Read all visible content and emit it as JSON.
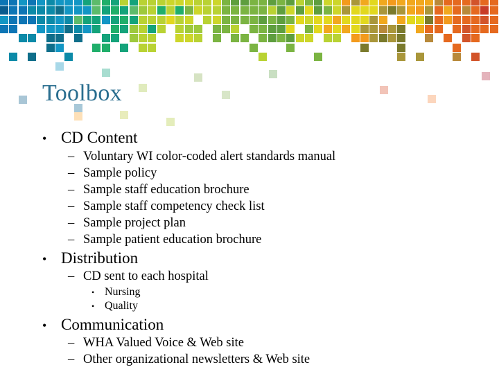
{
  "slide": {
    "title": "Toolbox",
    "sections": [
      {
        "label": "CD Content",
        "items": [
          {
            "label": "Voluntary WI color-coded alert standards manual",
            "subitems": []
          },
          {
            "label": "Sample policy",
            "subitems": []
          },
          {
            "label": "Sample staff education brochure",
            "subitems": []
          },
          {
            "label": "Sample staff competency check list",
            "subitems": []
          },
          {
            "label": "Sample project plan",
            "subitems": []
          },
          {
            "label": "Sample patient education brochure",
            "subitems": []
          }
        ]
      },
      {
        "label": "Distribution",
        "items": [
          {
            "label": "CD sent to each hospital",
            "subitems": [
              "Nursing",
              "Quality"
            ]
          }
        ]
      },
      {
        "label": "Communication",
        "items": [
          {
            "label": "WHA Valued Voice & Web site",
            "subitems": []
          },
          {
            "label": "Other organizational newsletters & Web site",
            "subitems": []
          }
        ]
      }
    ],
    "bullets": {
      "level1": "•",
      "level2": "–",
      "level3": "•"
    }
  },
  "decoration": {
    "mosaic_palette": {
      "a": "#0a5b8e",
      "b": "#0d75b5",
      "c": "#1296c4",
      "d": "#0c8aa8",
      "e": "#0f6e8a",
      "f": "#14a37a",
      "g": "#1fae6a",
      "h": "#5dbb6b",
      "i": "#9ec93c",
      "j": "#b9d233",
      "k": "#cdd62a",
      "l": "#7bb442",
      "m": "#5e9e3e",
      "n": "#e2d81e",
      "o": "#f1a81e",
      "p": "#f39a1c",
      "q": "#a9963a",
      "r": "#7a7a2c",
      "s": "#e5691f",
      "t": "#d2542a",
      "u": "#c83c28",
      "v": "#a52a25",
      "w": "#cc1f24",
      "x": "#6f1515",
      "y": "#c32a6e",
      "z": "#b8893a"
    },
    "mosaic_rows": [
      "bbcbcdcccfhgfjfjjjkkkjjklmmllmlmjlmkkpqonopoooozssstsssppssswwvwwvw",
      "abbdddeccchfgfhijgjglkjjllllljmkmnmlkqnnnqrqopqsoszsussussvsvyvwwvx",
      "cbbbddcdhffcfgfjjjnjk.jkllllmlmlnknnonnnqo.onnrspssstsvsstvwwvwvxwv",
      "bb..cccedcf.gfijfj.jii.llj.llmmn.lnononqqzqr.oss.stssssvwwvw.wvw",
      "..dd.ee.e..ff.ijj..kkj.l.ll.lmlmkk.jj.ppqrqr..z.s.ts...t.wwvwx",
      ".....ec...gg.f.jj..........l...l.......r...r.....s......v..w",
      ".d.e...d....................j.....l........q.q...z.t...s.......w"
    ],
    "faded_squares": [
      {
        "color": "#a8d8e8"
      },
      {
        "color": "#a8ddd0"
      },
      {
        "color": "#a9c6d6"
      },
      {
        "color": "#a8c8d8"
      },
      {
        "color": "#e0ebbd"
      },
      {
        "color": "#e4edbb"
      },
      {
        "color": "#e8ecbb"
      },
      {
        "color": "#d6e3c3"
      },
      {
        "color": "#d8e6c8"
      },
      {
        "color": "#c9dfc2"
      },
      {
        "color": "#fde0b8"
      },
      {
        "color": "#f2c4b8"
      },
      {
        "color": "#fcd6bd"
      },
      {
        "color": "#e4b4bc"
      }
    ]
  }
}
